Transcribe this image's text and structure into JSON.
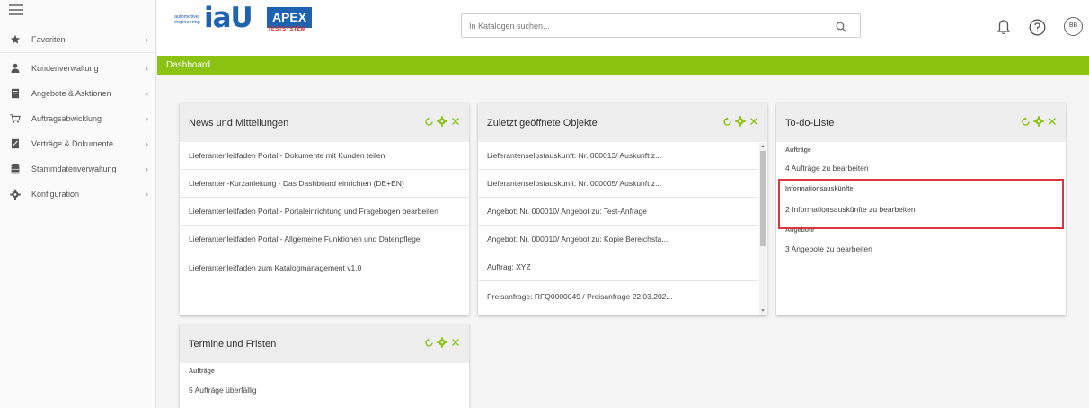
{
  "sidebar": {
    "items": [
      {
        "label": "Favoriten",
        "icon": "star-icon"
      },
      {
        "label": "Kundenverwaltung",
        "icon": "person-icon"
      },
      {
        "label": "Angebote & Asktionen",
        "icon": "document-icon"
      },
      {
        "label": "Auftragsabwicklung",
        "icon": "cart-icon"
      },
      {
        "label": "Verträge & Dokumente",
        "icon": "contract-icon"
      },
      {
        "label": "Stammdatenverwaltung",
        "icon": "database-icon"
      },
      {
        "label": "Konfiguration",
        "icon": "gear-icon"
      }
    ]
  },
  "header": {
    "logo_small": "automotive engineering",
    "logo_brand": "iaU",
    "logo_product": "APEX",
    "logo_env": "TESTSYSTEM",
    "search_placeholder": "In Katalogen suchen...",
    "avatar_initials": "BB",
    "brand_color": "#1e62b0",
    "env_color": "#e0261c"
  },
  "breadcrumb": {
    "title": "Dashboard",
    "color": "#8cc312"
  },
  "panels": {
    "news": {
      "title": "News und Mitteilungen",
      "items": [
        "Lieferantenleitfaden Portal - Dokumente mit Kunden teilen",
        "Lieferanten-Kurzanleitung - Das Dashboard einrichten (DE+EN)",
        "Lieferantenleitfaden Portal - Portaleinrichtung und Fragebogen bearbeiten",
        "Lieferantenleitfaden Portal - Allgemeine Funktionen und Datenpflege",
        "Lieferantenleitfaden zum Katalogmanagement v1.0"
      ]
    },
    "recent": {
      "title": "Zuletzt geöffnete Objekte",
      "items": [
        "Lieferantenselbstauskunft: Nr. 000013/ Auskunft z...",
        "Lieferantenselbstauskunft: Nr. 000005/ Auskunft z...",
        "Angebot: Nr. 000010/ Angebot zu: Test-Anfrage",
        "Angebot: Nr. 000010/ Angebot zu: Kopie Bereichsta...",
        "Auftrag: XYZ",
        "Preisanfrage: RFQ0000049 / Preisanfrage 22.03.202..."
      ]
    },
    "todo": {
      "title": "To-do-Liste",
      "sections": [
        {
          "title": "Aufträge",
          "item": "4 Aufträge zu bearbeiten"
        },
        {
          "title": "Informationsauskünfte",
          "item": "2 Informationsauskünfte zu bearbeiten"
        },
        {
          "title": "Angebote",
          "item": "3 Angebote zu bearbeiten"
        }
      ]
    },
    "deadlines": {
      "title": "Termine und Fristen",
      "sections": [
        {
          "title": "Aufträge",
          "item": "5 Aufträge überfällig"
        }
      ]
    }
  },
  "colors": {
    "action_green": "#8cc312",
    "highlight_red": "#d9363e"
  }
}
